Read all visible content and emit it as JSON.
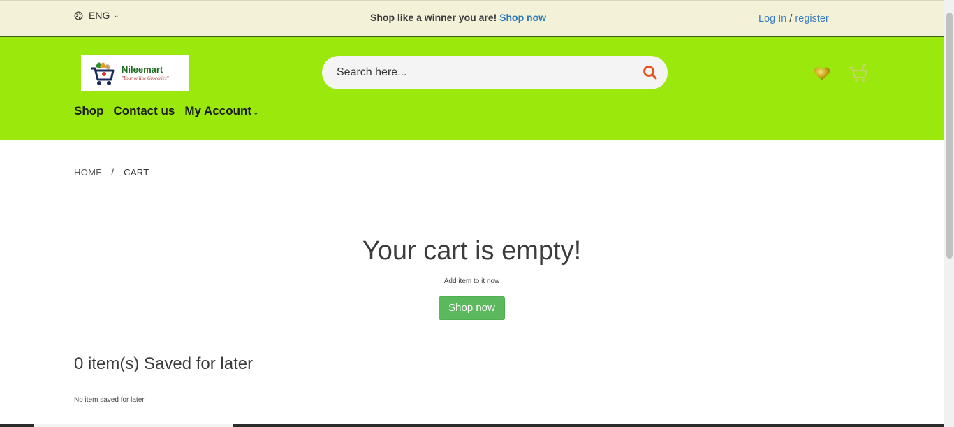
{
  "topbar": {
    "language": "ENG",
    "promo_text": "Shop like a winner you are!",
    "promo_link": "Shop now",
    "login": "Log In",
    "separator": "/",
    "register": "register"
  },
  "header": {
    "logo_name": "Nileemart",
    "logo_tagline": "\"Your online Groceries\"",
    "search_placeholder": "Search here...",
    "nav": [
      "Shop",
      "Contact us",
      "My Account"
    ]
  },
  "breadcrumb": {
    "home": "HOME",
    "separator": "/",
    "current": "CART"
  },
  "cart": {
    "empty_title": "Your cart is empty!",
    "empty_sub": "Add item to it now",
    "shop_button": "Shop now"
  },
  "saved": {
    "title": "0 item(s) Saved for later",
    "empty": "No item saved for later"
  },
  "colors": {
    "header_bg": "#9be80c",
    "topbar_bg": "#f3f1d8",
    "button_green": "#5cb85c",
    "search_icon": "#e8501c",
    "link_blue": "#2e7ab8"
  },
  "icons": [
    "globe-icon",
    "chevron-down-icon",
    "search-icon",
    "heart-icon",
    "cart-icon"
  ]
}
